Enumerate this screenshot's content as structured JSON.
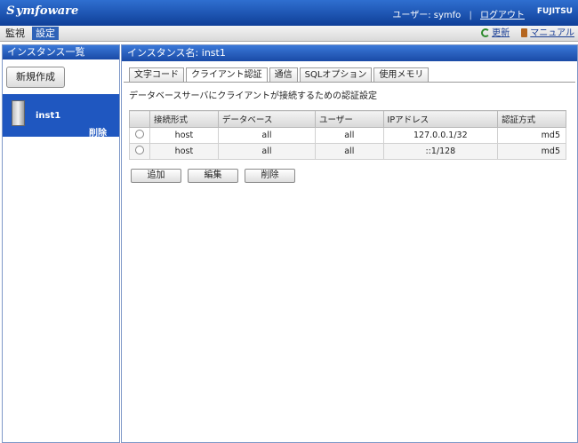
{
  "header": {
    "logo_mark": "S",
    "logo_text": "ymfoware",
    "user_label": "ユーザー: symfo",
    "logout_label": "ログアウト",
    "brand": "FUJITSU"
  },
  "nav": {
    "tabs": [
      {
        "label": "監視"
      },
      {
        "label": "設定"
      }
    ],
    "refresh_label": "更新",
    "manual_label": "マニュアル"
  },
  "left_panel": {
    "title": "インスタンス一覧",
    "create_button": "新規作成",
    "instance": {
      "name": "inst1",
      "delete_label": "削除"
    }
  },
  "main": {
    "title": "インスタンス名: inst1",
    "tabs": [
      {
        "label": "文字コード"
      },
      {
        "label": "クライアント認証"
      },
      {
        "label": "通信"
      },
      {
        "label": "SQLオプション"
      },
      {
        "label": "使用メモリ"
      }
    ],
    "description": "データベースサーバにクライアントが接続するための認証設定",
    "table": {
      "headers": [
        "接続形式",
        "データベース",
        "ユーザー",
        "IPアドレス",
        "認証方式"
      ],
      "rows": [
        {
          "conn": "host",
          "db": "all",
          "user": "all",
          "ip": "127.0.0.1/32",
          "auth": "md5"
        },
        {
          "conn": "host",
          "db": "all",
          "user": "all",
          "ip": "::1/128",
          "auth": "md5"
        }
      ]
    },
    "buttons": {
      "add": "追加",
      "edit": "編集",
      "delete": "削除"
    }
  }
}
